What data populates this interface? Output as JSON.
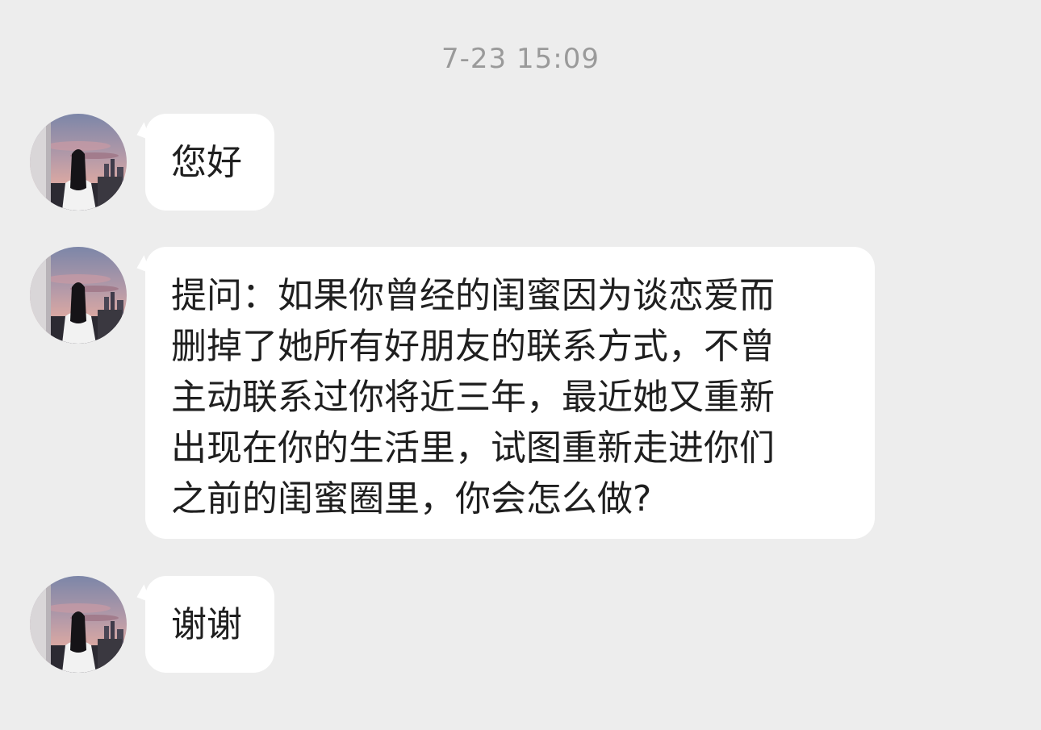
{
  "chat": {
    "timestamp": "7-23 15:09",
    "messages": [
      {
        "lines": [
          "您好"
        ]
      },
      {
        "lines": [
          "提问：如果你曾经的闺蜜因为谈恋爱而",
          "删掉了她所有好朋友的联系方式，不曾",
          "主动联系过你将近三年，最近她又重新",
          "出现在你的生活里，试图重新走进你们",
          "之前的闺蜜圈里，你会怎么做?"
        ]
      },
      {
        "lines": [
          "谢谢"
        ]
      }
    ]
  },
  "colors": {
    "background": "#EDEDED",
    "bubble": "#FFFFFF",
    "text": "#1F1F1F",
    "timestamp": "#9A9A9A"
  },
  "icons": {
    "avatar": "avatar-girl-window-icon"
  }
}
